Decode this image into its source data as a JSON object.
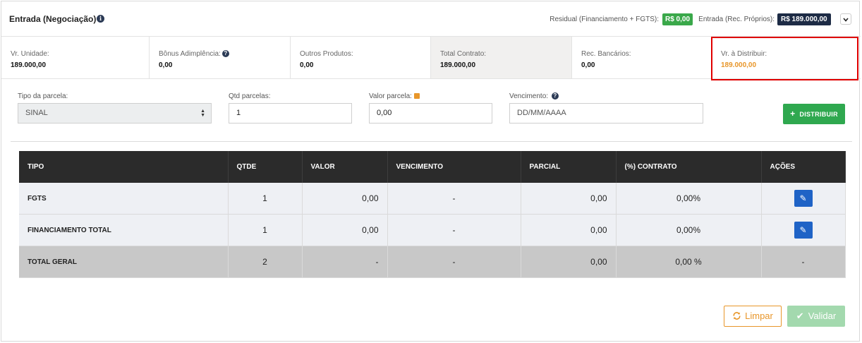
{
  "header": {
    "title": "Entrada (Negociação)",
    "info_icon": "info-icon",
    "residual_label": "Residual (Financiamento + FGTS):",
    "residual_value": "R$ 0,00",
    "entrada_label": "Entrada (Rec. Próprios):",
    "entrada_value": "R$ 189.000,00",
    "collapse_icon": "chevron-down-icon"
  },
  "summary": [
    {
      "label": "Vr. Unidade:",
      "value": "189.000,00"
    },
    {
      "label": "Bônus Adimplência:",
      "value": "0,00"
    },
    {
      "label": "Outros Produtos:",
      "value": "0,00"
    },
    {
      "label": "Total Contrato:",
      "value": "189.000,00"
    },
    {
      "label": "Rec. Bancários:",
      "value": "0,00"
    },
    {
      "label": "Vr. à Distribuir:",
      "value": "189.000,00"
    }
  ],
  "form": {
    "tipo_label": "Tipo da parcela:",
    "tipo_value": "SINAL",
    "qtd_label": "Qtd parcelas:",
    "qtd_value": "1",
    "valor_label": "Valor parcela:",
    "valor_value": "0,00",
    "venc_label": "Vencimento:",
    "venc_placeholder": "DD/MM/AAAA",
    "distribuir_label": "DISTRIBUIR"
  },
  "table": {
    "headers": [
      "TIPO",
      "QTDE",
      "VALOR",
      "VENCIMENTO",
      "PARCIAL",
      "(%) CONTRATO",
      "AÇÕES"
    ],
    "rows": [
      {
        "tipo": "FGTS",
        "qtde": "1",
        "valor": "0,00",
        "vencimento": "-",
        "parcial": "0,00",
        "contrato": "0,00%"
      },
      {
        "tipo": "FINANCIAMENTO TOTAL",
        "qtde": "1",
        "valor": "0,00",
        "vencimento": "-",
        "parcial": "0,00",
        "contrato": "0,00%"
      }
    ],
    "total": {
      "tipo": "TOTAL GERAL",
      "qtde": "2",
      "valor": "-",
      "vencimento": "-",
      "parcial": "0,00",
      "contrato": "0,00 %",
      "acoes": "-"
    }
  },
  "footer": {
    "limpar_label": "Limpar",
    "validar_label": "Validar"
  },
  "colors": {
    "highlight_value": "#e8962a",
    "badge_green": "#3aa84a",
    "badge_navy": "#1d2b45",
    "table_header": "#2b2b2b",
    "distribuir_button": "#2fa84f",
    "edit_button": "#1f63c6",
    "highlight_box": "#e00000"
  }
}
